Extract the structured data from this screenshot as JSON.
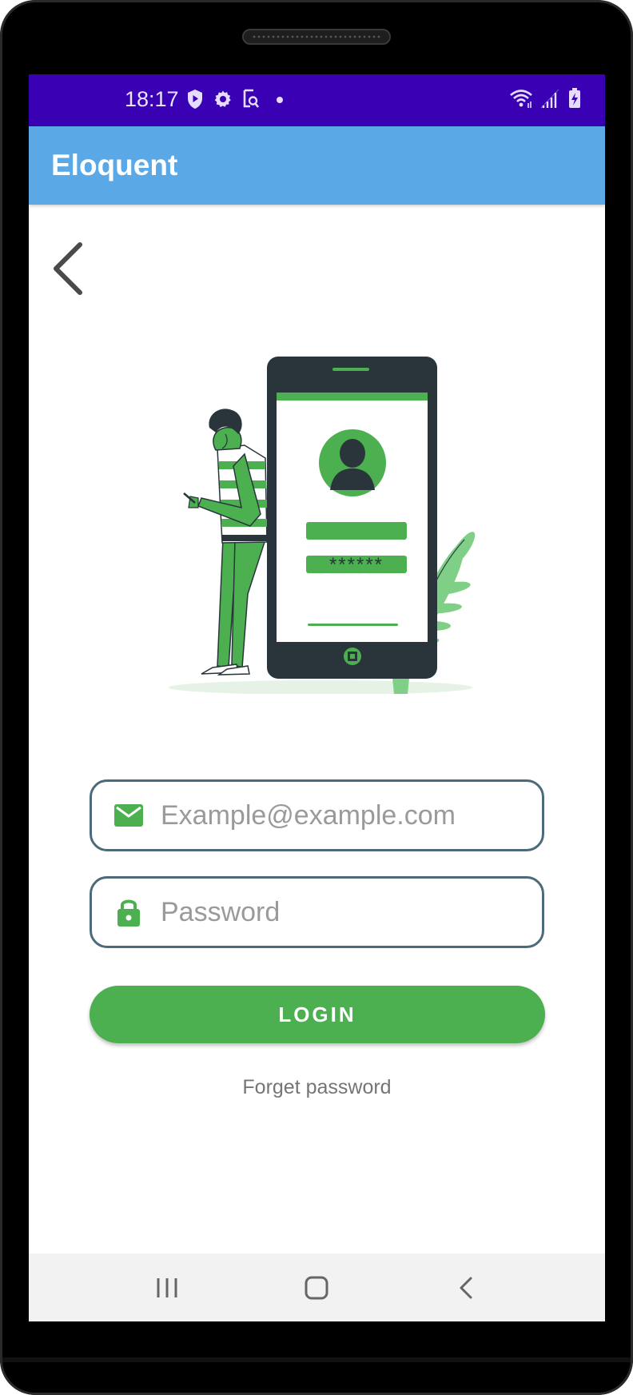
{
  "status_bar": {
    "time": "18:17",
    "left_icons": [
      "shield-play-icon",
      "gear-icon",
      "screen-search-icon",
      "dot-icon"
    ],
    "right_icons": [
      "wifi-icon",
      "signal-icon",
      "battery-charging-icon"
    ],
    "background": "#3a00b4"
  },
  "app_bar": {
    "title": "Eloquent",
    "background": "#5aa8e6"
  },
  "illustration": {
    "password_mask": "******"
  },
  "form": {
    "email_placeholder": "Example@example.com",
    "email_value": "",
    "password_placeholder": "Password",
    "password_value": "",
    "login_label": "LOGIN",
    "forget_label": "Forget password"
  },
  "colors": {
    "accent_green": "#4caf50",
    "field_border": "#4c6b7a"
  },
  "nav_bar": {
    "items": [
      "recents-icon",
      "home-icon",
      "back-icon"
    ]
  }
}
